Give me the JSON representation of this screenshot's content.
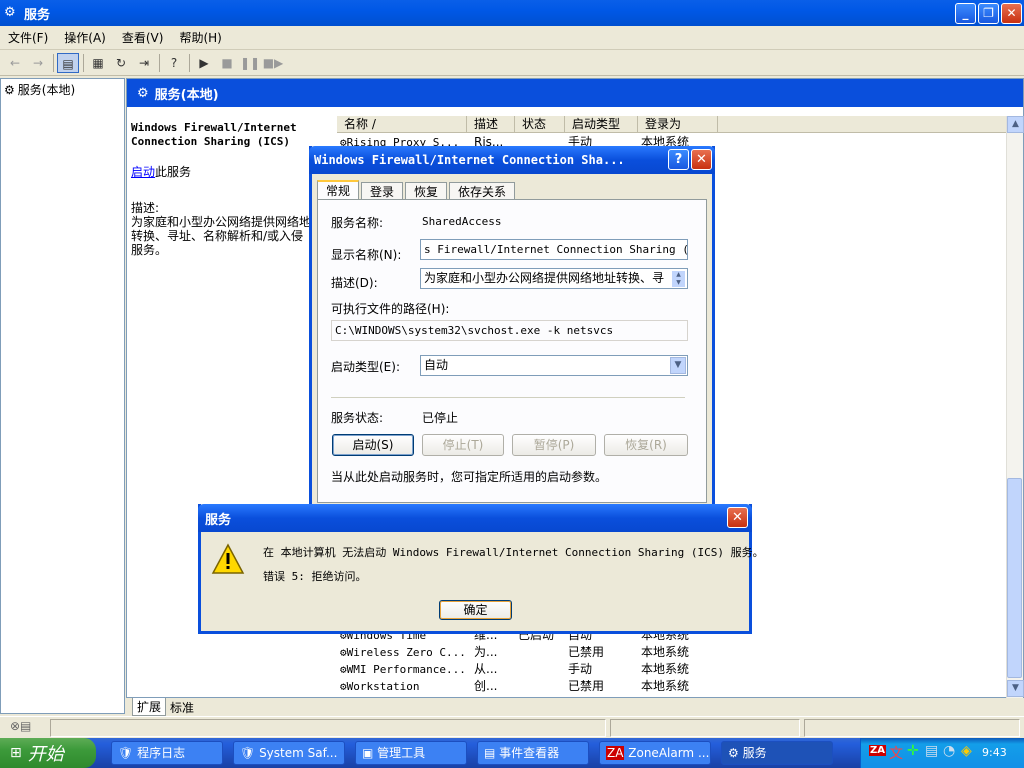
{
  "window": {
    "title": "服务",
    "icon": "gears-icon"
  },
  "menu": [
    "文件(F)",
    "操作(A)",
    "查看(V)",
    "帮助(H)"
  ],
  "tree": {
    "root": "服务(本地)"
  },
  "right_header": "服务(本地)",
  "detail": {
    "service_title_line1": "Windows Firewall/Internet",
    "service_title_line2": "Connection Sharing (ICS)",
    "start_link": "启动",
    "start_suffix": "此服务",
    "desc_label": "描述:",
    "desc_line1": "为家庭和小型办公网络提供网络地",
    "desc_line2": "转换、寻址、名称解析和/或入侵",
    "desc_line3": "服务。"
  },
  "columns": [
    "名称 /",
    "描述",
    "状态",
    "启动类型",
    "登录为"
  ],
  "rows_top": [
    {
      "name": "Rising Proxy S...",
      "desc": "Ris...",
      "status": "",
      "startup": "手动",
      "logon": "本地系统"
    }
  ],
  "rows_bottom": [
    {
      "name": "Windows Time",
      "desc": "维...",
      "status": "已启动",
      "startup": "自动",
      "logon": "本地系统"
    },
    {
      "name": "Wireless Zero C...",
      "desc": "为...",
      "status": "",
      "startup": "已禁用",
      "logon": "本地系统"
    },
    {
      "name": "WMI Performance...",
      "desc": "从...",
      "status": "",
      "startup": "手动",
      "logon": "本地系统"
    },
    {
      "name": "Workstation",
      "desc": "创...",
      "status": "",
      "startup": "已禁用",
      "logon": "本地系统"
    }
  ],
  "bottom_tabs": [
    "扩展",
    "标准"
  ],
  "props": {
    "title": "Windows Firewall/Internet Connection Sha...",
    "tabs": [
      "常规",
      "登录",
      "恢复",
      "依存关系"
    ],
    "service_name_label": "服务名称:",
    "service_name": "SharedAccess",
    "display_name_label": "显示名称(N):",
    "display_name": "s Firewall/Internet Connection Sharing (ICS)",
    "description_label": "描述(D):",
    "description": "为家庭和小型办公网络提供网络地址转换、寻",
    "path_label": "可执行文件的路径(H):",
    "path": "C:\\WINDOWS\\system32\\svchost.exe -k netsvcs",
    "startup_label": "启动类型(E):",
    "startup_value": "自动",
    "status_label": "服务状态:",
    "status_value": "已停止",
    "btn_start": "启动(S)",
    "btn_stop": "停止(T)",
    "btn_pause": "暂停(P)",
    "btn_resume": "恢复(R)",
    "hint": "当从此处启动服务时，您可指定所适用的启动参数。"
  },
  "error": {
    "title": "服务",
    "line1": "在 本地计算机 无法启动 Windows Firewall/Internet Connection Sharing (ICS) 服务。",
    "line2": "错误 5: 拒绝访问。",
    "ok": "确定",
    "icon": "warning-icon"
  },
  "taskbar": {
    "start": "开始",
    "tasks": [
      "程序日志",
      "System Saf...",
      "管理工具",
      "事件查看器",
      "ZoneAlarm ...",
      "服务"
    ],
    "clock": "9:43"
  },
  "colors": {
    "titlebar": "#0a4fdc",
    "face": "#ece9d8",
    "taskbar": "#245edb",
    "start": "#3c9a3a"
  }
}
